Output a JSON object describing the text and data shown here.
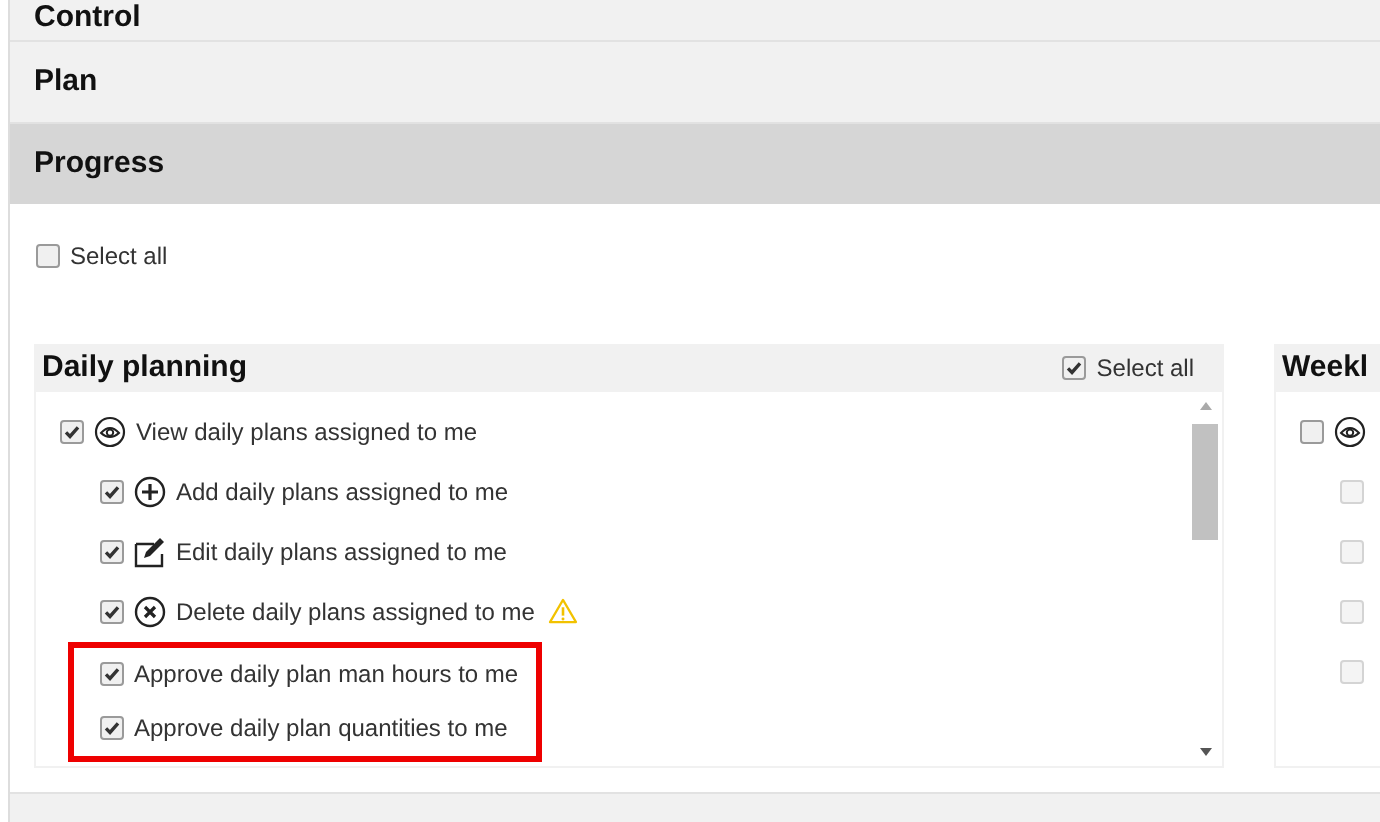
{
  "sections": [
    {
      "title": "Control",
      "selected": false
    },
    {
      "title": "Plan",
      "selected": false
    },
    {
      "title": "Progress",
      "selected": true
    }
  ],
  "select_all": {
    "label": "Select all",
    "checked": false
  },
  "panels": [
    {
      "title": "Daily planning",
      "select_all": {
        "label": "Select all",
        "checked": true
      },
      "items": [
        {
          "label": "View daily plans assigned to me",
          "kind": "view",
          "checked": true,
          "disabled": false,
          "children": [
            {
              "label": "Add daily plans assigned to me",
              "kind": "add",
              "checked": true,
              "disabled": false,
              "warning": false,
              "highlighted": false
            },
            {
              "label": "Edit daily plans assigned to me",
              "kind": "edit",
              "checked": true,
              "disabled": false,
              "warning": false,
              "highlighted": false
            },
            {
              "label": "Delete daily plans assigned to me",
              "kind": "delete",
              "checked": true,
              "disabled": false,
              "warning": true,
              "highlighted": false
            },
            {
              "label": "Approve daily plan man hours to me",
              "kind": "plain",
              "checked": true,
              "disabled": false,
              "warning": false,
              "highlighted": true
            },
            {
              "label": "Approve daily plan quantities to me",
              "kind": "plain",
              "checked": true,
              "disabled": false,
              "warning": false,
              "highlighted": true
            }
          ]
        }
      ]
    },
    {
      "title": "Weekl",
      "items": [
        {
          "kind": "view",
          "checked": false,
          "disabled": false,
          "children": [
            {
              "checked": false,
              "disabled": true
            },
            {
              "checked": false,
              "disabled": true
            },
            {
              "checked": false,
              "disabled": true
            },
            {
              "checked": false,
              "disabled": true
            }
          ]
        }
      ]
    }
  ]
}
